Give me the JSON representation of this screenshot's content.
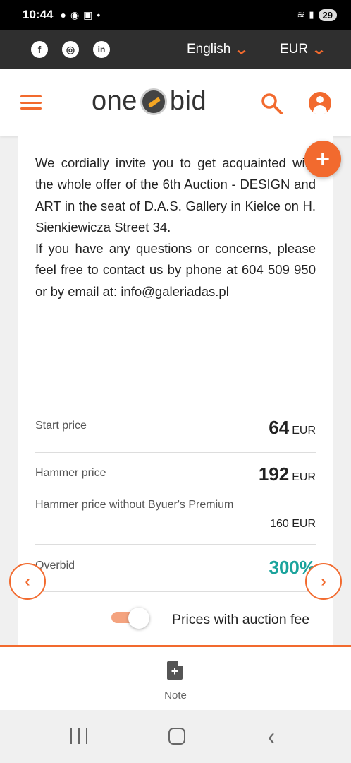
{
  "status_bar": {
    "time": "10:44",
    "battery": "29"
  },
  "topbar": {
    "social": [
      "facebook-icon",
      "instagram-icon",
      "linkedin-icon"
    ],
    "social_glyphs": [
      "f",
      "◎",
      "in"
    ],
    "language": "English",
    "currency": "EUR"
  },
  "header": {
    "logo_left": "one",
    "logo_right": "bid"
  },
  "description": {
    "p1": "We cordially invite you to get acquainted with the whole offer of the 6th Auction - DESIGN and ART in the seat of D.A.S. Gallery in Kielce on H. Sienkiewicza Street 34.",
    "p2": "If you have any questions or concerns, please feel free to contact us by phone at 604 509 950 or by email at: info@galeriadas.pl"
  },
  "prices": {
    "start_label": "Start price",
    "start_value": "64",
    "start_currency": "EUR",
    "hammer_label": "Hammer price",
    "hammer_value": "192",
    "hammer_currency": "EUR",
    "hammer_no_premium_label": "Hammer price without Byuer's Premium",
    "hammer_no_premium_value": "160 EUR",
    "overbid_label": "Overbid",
    "overbid_value": "300%"
  },
  "toggle": {
    "label": "Prices with auction fee",
    "on": true
  },
  "bottom_bar": {
    "note_label": "Note"
  },
  "colors": {
    "accent": "#f26a2e",
    "overbid": "#1ba39c",
    "topbar": "#2f2f2f"
  }
}
